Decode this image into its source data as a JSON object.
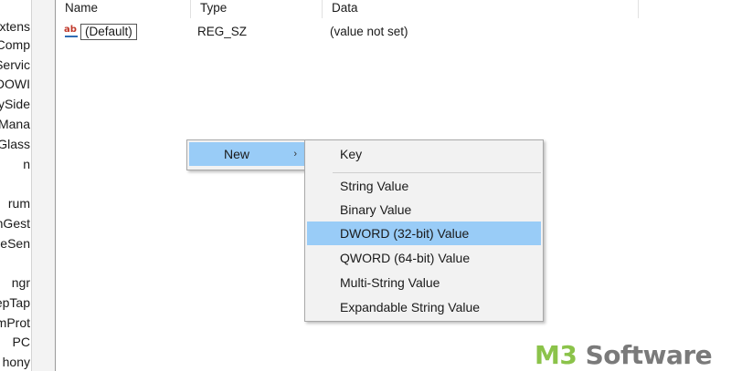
{
  "tree": {
    "items": [
      "Extens",
      "Comp",
      "Servic",
      "DOWI",
      "ySide",
      "Mana",
      "Glass",
      "n",
      "rum",
      "hGest",
      "geSen",
      "ngr",
      "epTap",
      "mProt",
      "PC",
      "hony"
    ]
  },
  "columns": {
    "name": "Name",
    "type": "Type",
    "data": "Data"
  },
  "rows": [
    {
      "name": "(Default)",
      "type": "REG_SZ",
      "data": "(value not set)",
      "icon": "ab-string-value-icon"
    }
  ],
  "context_menu": {
    "new_label": "New",
    "arrow": "›"
  },
  "submenu": {
    "items": [
      "Key",
      "String Value",
      "Binary Value",
      "DWORD (32-bit) Value",
      "QWORD (64-bit) Value",
      "Multi-String Value",
      "Expandable String Value"
    ],
    "highlighted": "DWORD (32-bit) Value"
  },
  "watermark": {
    "prefix": "M3",
    "suffix": " Software"
  },
  "colors": {
    "menu_highlight": "#99ccf7",
    "menu_background": "#f2f2f2",
    "watermark_green": "#8bc34a",
    "watermark_gray": "#7a7a7a"
  }
}
